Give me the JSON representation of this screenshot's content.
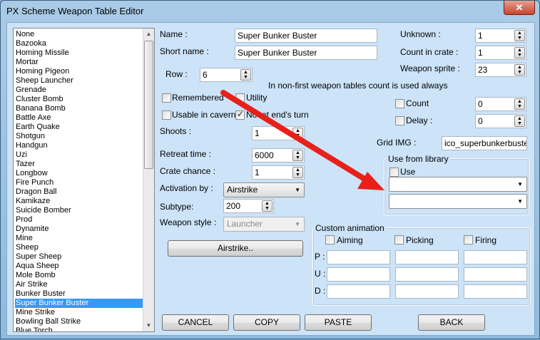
{
  "window": {
    "title": "PX Scheme Weapon Table Editor",
    "close_glyph": "✕"
  },
  "weapon_list": {
    "items": [
      "None",
      "Bazooka",
      "Homing Missile",
      "Mortar",
      "Homing Pigeon",
      "Sheep Launcher",
      "Grenade",
      "Cluster Bomb",
      "Banana Bomb",
      "Battle Axe",
      "Earth Quake",
      "Shotgun",
      "Handgun",
      "Uzi",
      "Tazer",
      "Longbow",
      "Fire Punch",
      "Dragon Ball",
      "Kamikaze",
      "Suicide Bomber",
      "Prod",
      "Dynamite",
      "Mine",
      "Sheep",
      "Super Sheep",
      "Aqua Sheep",
      "Mole Bomb",
      "Air Strike",
      "Bunker Buster",
      "Super Bunker Buster",
      "Mine Strike",
      "Bowling Ball Strike",
      "Blue Torch"
    ],
    "selected": "Super Bunker Buster"
  },
  "fields": {
    "name_label": "Name :",
    "name_value": "Super Bunker Buster",
    "short_label": "Short name :",
    "short_value": "Super Bunker Buster",
    "row_label": "Row :",
    "row_value": "6",
    "note": "In non-first weapon tables count is used always",
    "remembered": "Remembered",
    "utility": "Utility",
    "usable_cavern": "Usable in cavern",
    "not_end_turn": "Not at end's turn",
    "shoots_label": "Shoots :",
    "shoots_value": "1",
    "retreat_label": "Retreat time :",
    "retreat_value": "6000",
    "crate_label": "Crate chance :",
    "crate_value": "1",
    "activation_label": "Activation by :",
    "activation_value": "Airstrike",
    "subtype_label": "Subtype:",
    "subtype_value": "200",
    "style_label": "Weapon style :",
    "style_value": "Launcher",
    "airstrike_btn": "Airstrike..",
    "unknown_label": "Unknown :",
    "unknown_value": "1",
    "count_crate_label": "Count in crate :",
    "count_crate_value": "1",
    "sprite_label": "Weapon sprite :",
    "sprite_value": "23",
    "count_label": "Count",
    "count_value": "0",
    "delay_label": "Delay :",
    "delay_value": "0",
    "grid_label": "Grid IMG :",
    "grid_value": "ico_superbunkerbuster.p"
  },
  "library": {
    "title": "Use from library",
    "use_label": "Use"
  },
  "animation": {
    "title": "Custom animation",
    "aiming": "Aiming",
    "picking": "Picking",
    "firing": "Firing",
    "p": "P :",
    "u": "U :",
    "d": "D :"
  },
  "buttons": {
    "cancel": "CANCEL",
    "copy": "COPY",
    "paste": "PASTE",
    "back": "BACK"
  },
  "colors": {
    "client_bg": "#cce3f8",
    "selection": "#3399ff",
    "annotation_arrow": "#e8201a"
  }
}
